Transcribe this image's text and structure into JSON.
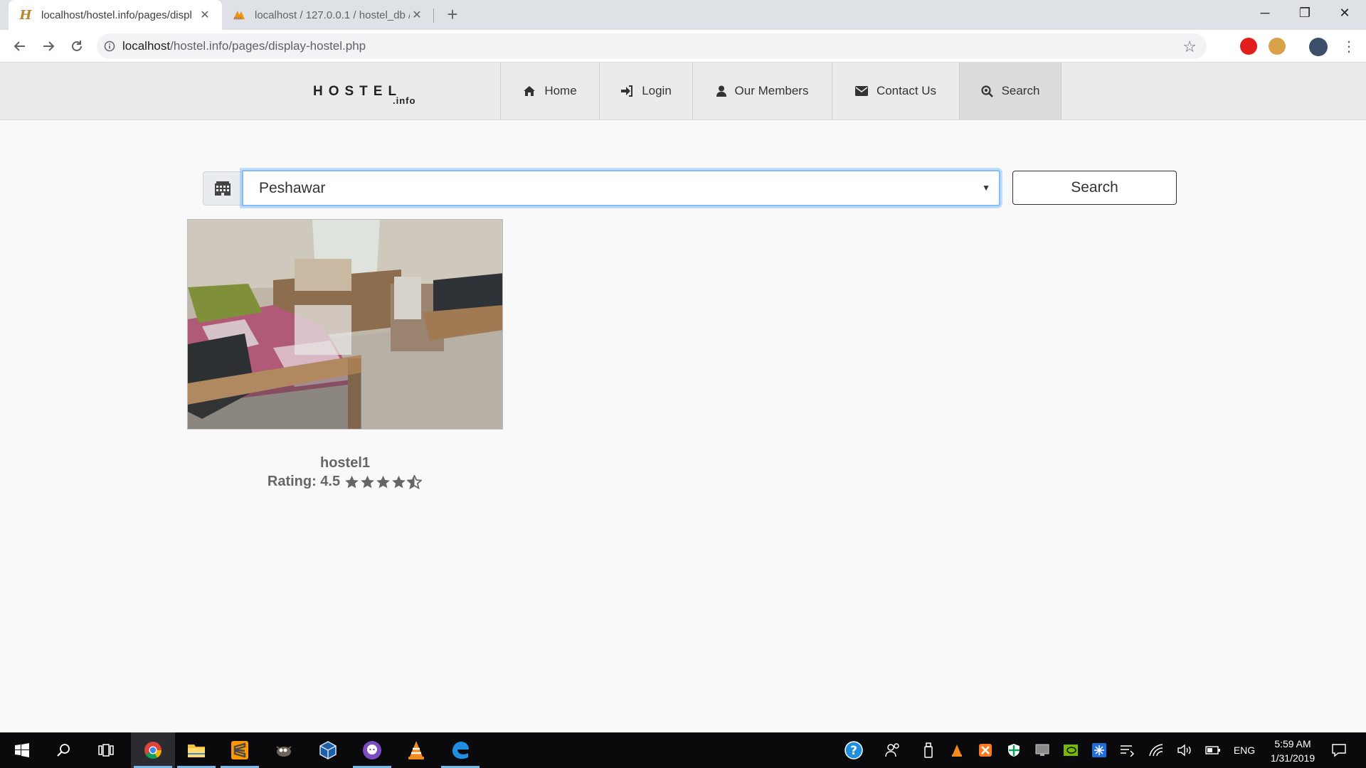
{
  "browser": {
    "tabs": [
      {
        "title": "localhost/hostel.info/pages/displ",
        "favicon": "hostel-h-icon"
      },
      {
        "title": "localhost / 127.0.0.1 / hostel_db /",
        "favicon": "phpmyadmin-icon"
      }
    ],
    "url": {
      "host": "localhost",
      "path": "/hostel.info/pages/display-hostel.php"
    }
  },
  "site": {
    "logo": {
      "main": "HOSTEL",
      "sub": ".info"
    },
    "nav": [
      {
        "label": "Home",
        "icon": "home-icon"
      },
      {
        "label": "Login",
        "icon": "sign-in-icon"
      },
      {
        "label": "Our Members",
        "icon": "user-icon"
      },
      {
        "label": "Contact Us",
        "icon": "envelope-icon"
      },
      {
        "label": "Search",
        "icon": "search-icon"
      }
    ]
  },
  "search": {
    "city_icon": "building-icon",
    "selected_city": "Peshawar",
    "button_label": "Search"
  },
  "results": [
    {
      "name": "hostel1",
      "rating_label": "Rating: 4.5",
      "rating": 4.5,
      "max_rating": 5
    }
  ],
  "taskbar": {
    "clock_time": "5:59 AM",
    "clock_date": "1/31/2019",
    "language": "ENG"
  },
  "colors": {
    "accent_focus": "#80bdff",
    "nav_bg": "#ebebeb",
    "star": "#666666"
  }
}
